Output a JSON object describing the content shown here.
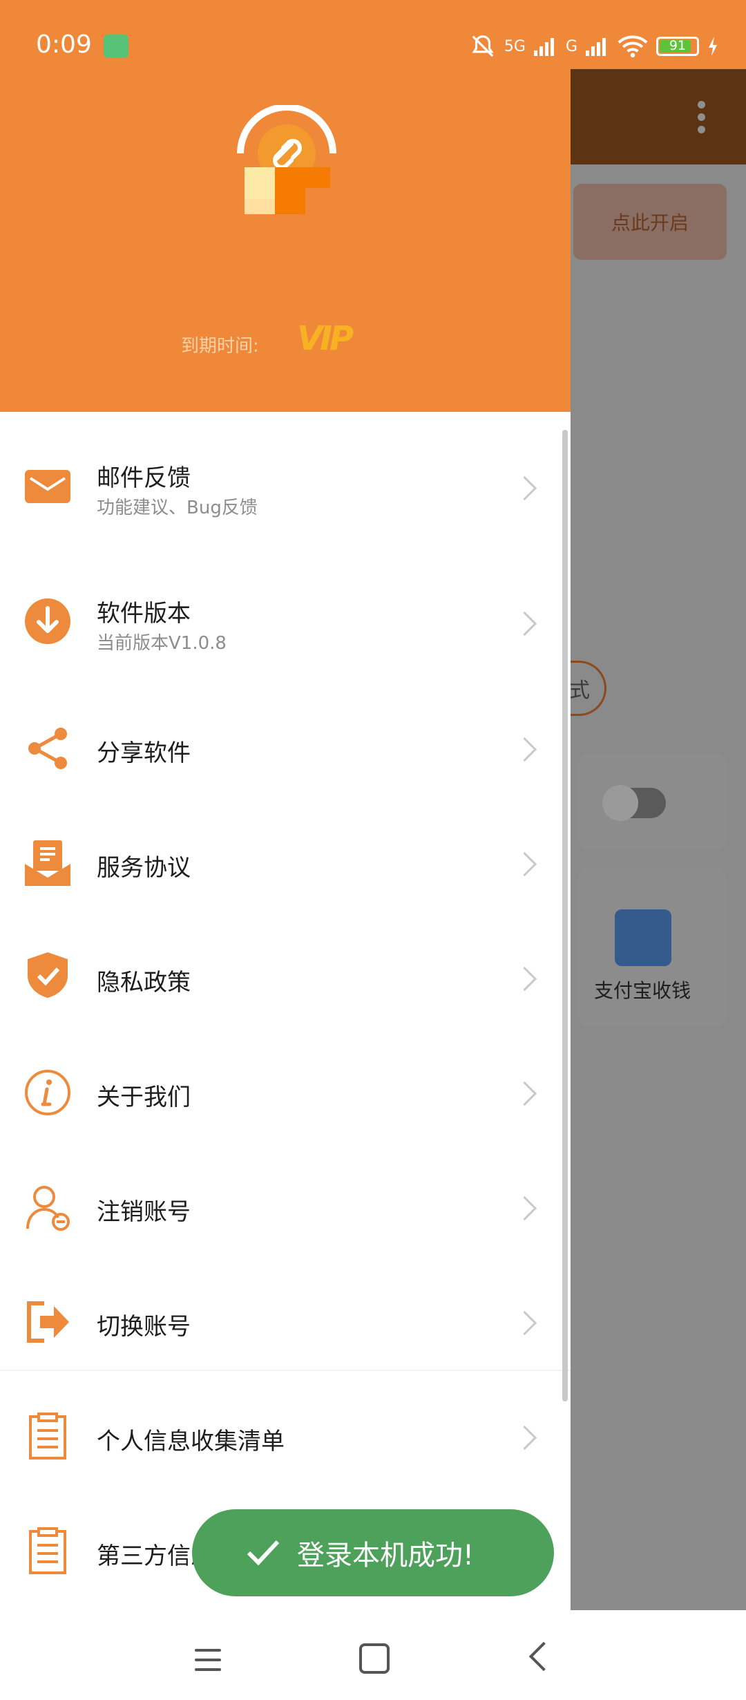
{
  "status_bar": {
    "time": "0:09",
    "battery": "91",
    "network_1": "5G",
    "network_2": "G"
  },
  "background_app": {
    "open_button": "点此开启",
    "pill_text": "式",
    "alipay_label": "支付宝收钱",
    "alipay_icon_char": "¥"
  },
  "drawer": {
    "expire_label": "到期时间:",
    "vip_badge": "VIP",
    "items": [
      {
        "title": "邮件反馈",
        "subtitle": "功能建议、Bug反馈",
        "icon": "mail-icon"
      },
      {
        "title": "软件版本",
        "subtitle": "当前版本V1.0.8",
        "icon": "download-icon"
      },
      {
        "title": "分享软件",
        "icon": "share-icon"
      },
      {
        "title": "服务协议",
        "icon": "agreement-icon"
      },
      {
        "title": "隐私政策",
        "icon": "shield-check-icon"
      },
      {
        "title": "关于我们",
        "icon": "info-icon"
      },
      {
        "title": "注销账号",
        "icon": "user-minus-icon"
      },
      {
        "title": "切换账号",
        "icon": "switch-account-icon"
      },
      {
        "title": "个人信息收集清单",
        "icon": "clipboard-icon"
      },
      {
        "title": "第三方信息共享清单",
        "icon": "clipboard-icon"
      }
    ]
  },
  "toast": {
    "message": "登录本机成功!",
    "icon": "checkmark-icon"
  },
  "nav_bar": {
    "icons": [
      "menu-icon",
      "home-icon",
      "back-icon"
    ]
  },
  "colors": {
    "brand_orange": "#f0883a",
    "toast_green": "#4ea15a",
    "vip_gold": "#f7b223"
  }
}
